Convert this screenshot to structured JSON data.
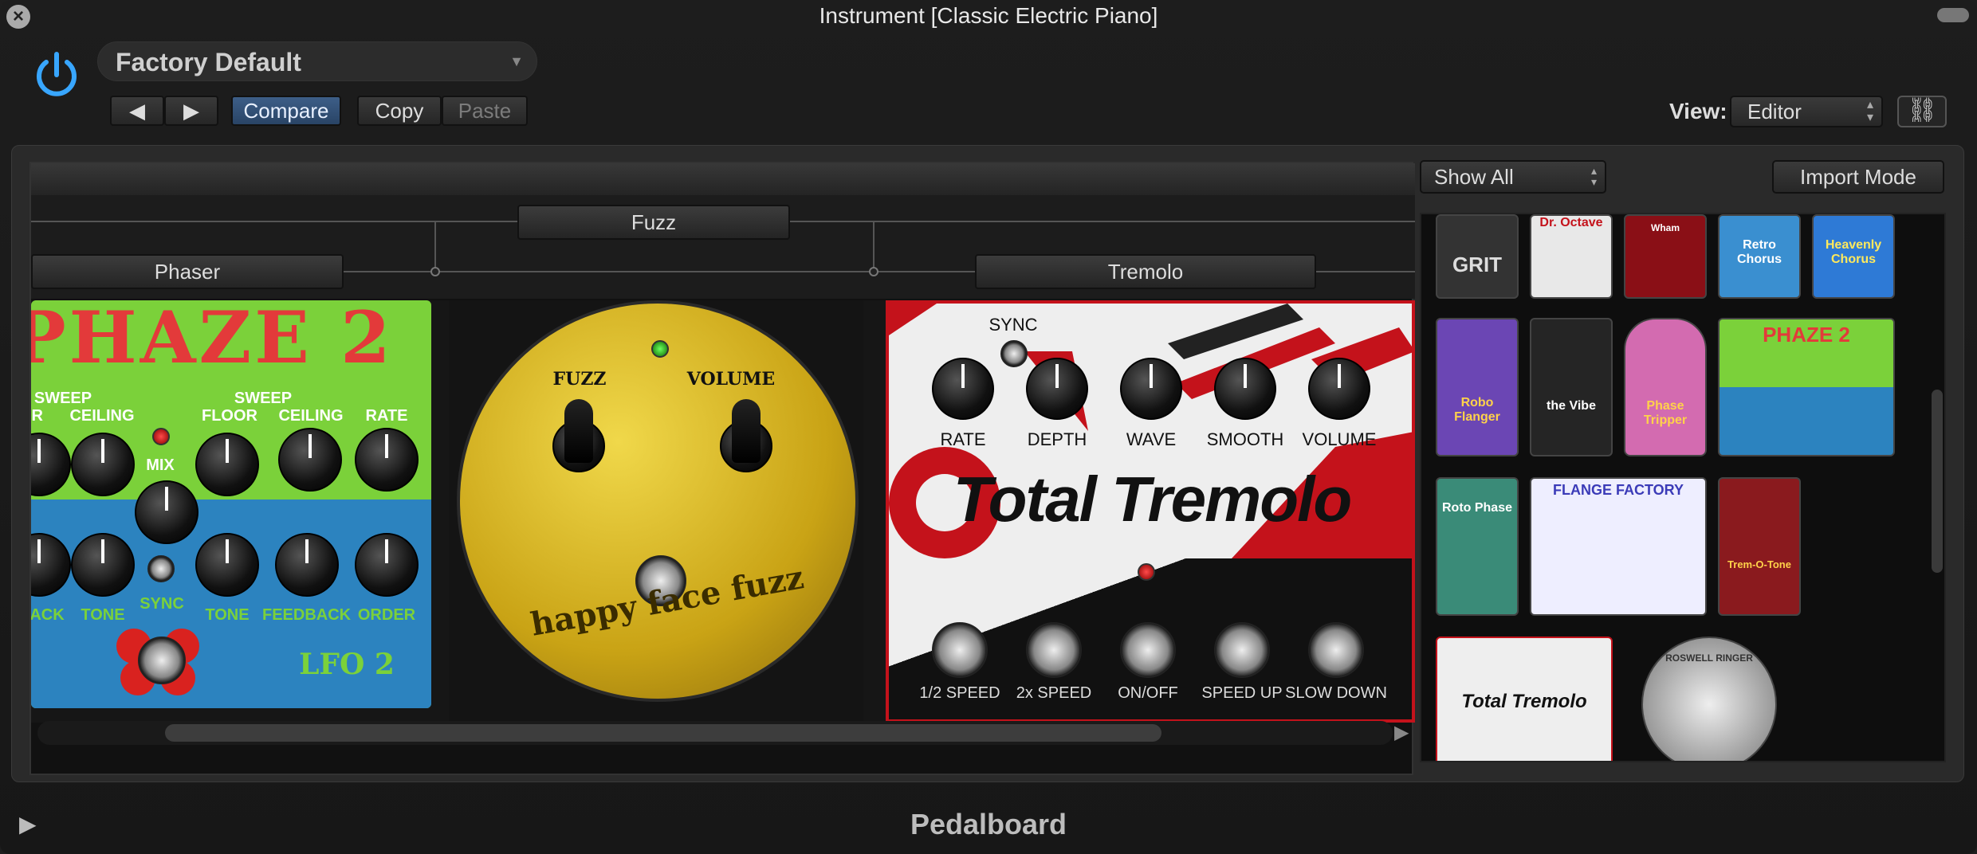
{
  "window": {
    "title": "Instrument [Classic Electric Piano]"
  },
  "header": {
    "preset": "Factory Default",
    "nav_prev": "◀",
    "nav_next": "▶",
    "compare": "Compare",
    "copy": "Copy",
    "paste": "Paste",
    "view_label": "View:",
    "view_value": "Editor"
  },
  "routing": {
    "bus_top": "Fuzz",
    "bus_left": "Phaser",
    "bus_right": "Tremolo"
  },
  "pedals": {
    "phaze": {
      "title": "PHAZE 2",
      "labels_top": [
        "SWEEP",
        "OR",
        "CEILING",
        "FLOOR",
        "SWEEP",
        "CEILING",
        "RATE"
      ],
      "mix": "MIX",
      "labels_bottom": [
        "ACK",
        "TONE",
        "SYNC",
        "TONE",
        "FEEDBACK",
        "ORDER"
      ],
      "lfo": "LFO 2"
    },
    "fuzz": {
      "knob1": "FUZZ",
      "knob2": "VOLUME",
      "name": "happy face fuzz"
    },
    "tremolo": {
      "sync": "SYNC",
      "knobs": [
        "RATE",
        "DEPTH",
        "WAVE",
        "SMOOTH",
        "VOLUME"
      ],
      "name": "Total Tremolo",
      "footswitches": [
        "1/2 SPEED",
        "2x SPEED",
        "ON/OFF",
        "SPEED UP",
        "SLOW DOWN"
      ]
    }
  },
  "browser": {
    "filter": "Show All",
    "import": "Import Mode",
    "thumbs": {
      "grit": "GRIT",
      "dr_octave": "Dr. Octave",
      "wham": "Wham",
      "retro_chorus": "Retro Chorus",
      "heavenly_chorus": "Heavenly Chorus",
      "robo_flanger": "Robo Flanger",
      "the_vibe": "the Vibe",
      "phase_tripper": "Phase Tripper",
      "phaze2": "PHAZE 2",
      "roto_phase": "Roto Phase",
      "flange_factory": "FLANGE FACTORY",
      "trem_o_tone": "Trem-O-Tone",
      "total_tremolo": "Total Tremolo",
      "roswell_ringer": "ROSWELL RINGER"
    }
  },
  "footer": {
    "title": "Pedalboard"
  },
  "colors": {
    "accent_blue": "#3d5e88",
    "power_blue": "#38a6ff",
    "tremolo_red": "#c4121b",
    "phaze_green": "#7bd13a",
    "fuzz_yellow": "#e0c232"
  }
}
